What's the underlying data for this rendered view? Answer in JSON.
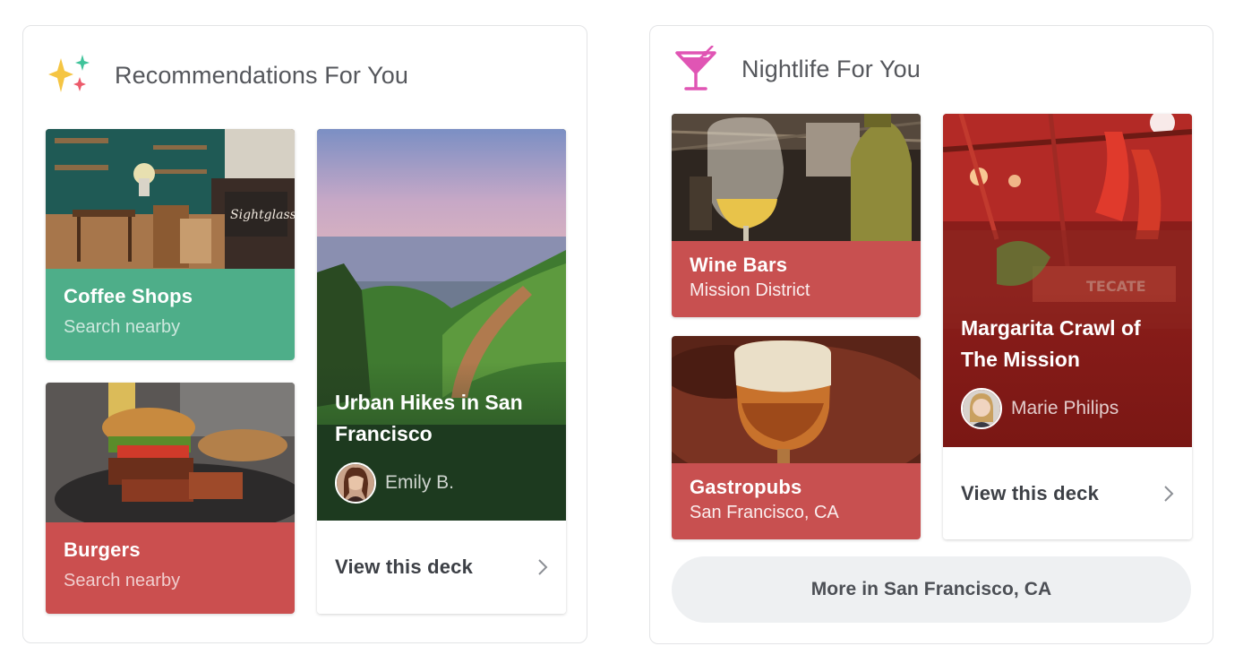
{
  "recommendations": {
    "title": "Recommendations For You",
    "icon": "sparkles-icon",
    "cards": [
      {
        "title": "Coffee Shops",
        "subtitle": "Search nearby",
        "color": "#4eae89"
      },
      {
        "title": "Burgers",
        "subtitle": "Search nearby",
        "color": "#cb4f4f"
      }
    ],
    "deck": {
      "title": "Urban Hikes in San Francisco",
      "author": "Emily B.",
      "link_label": "View this deck"
    }
  },
  "nightlife": {
    "title": "Nightlife For You",
    "icon": "cocktail-icon",
    "cards": [
      {
        "title": "Wine Bars",
        "subtitle": "Mission District",
        "color": "#c85050"
      },
      {
        "title": "Gastropubs",
        "subtitle": "San Francisco, CA",
        "color": "#c85050"
      }
    ],
    "deck": {
      "title": "Margarita Crawl of The Mission",
      "author": "Marie Philips",
      "link_label": "View this deck"
    },
    "more_button": "More in San Francisco, CA"
  },
  "colors": {
    "green": "#4eae89",
    "red": "#cb4f4f",
    "deck_dark_green": "#1d3a1f",
    "deck_dark_red": "#7a1714",
    "button_bg": "#eef0f2"
  }
}
